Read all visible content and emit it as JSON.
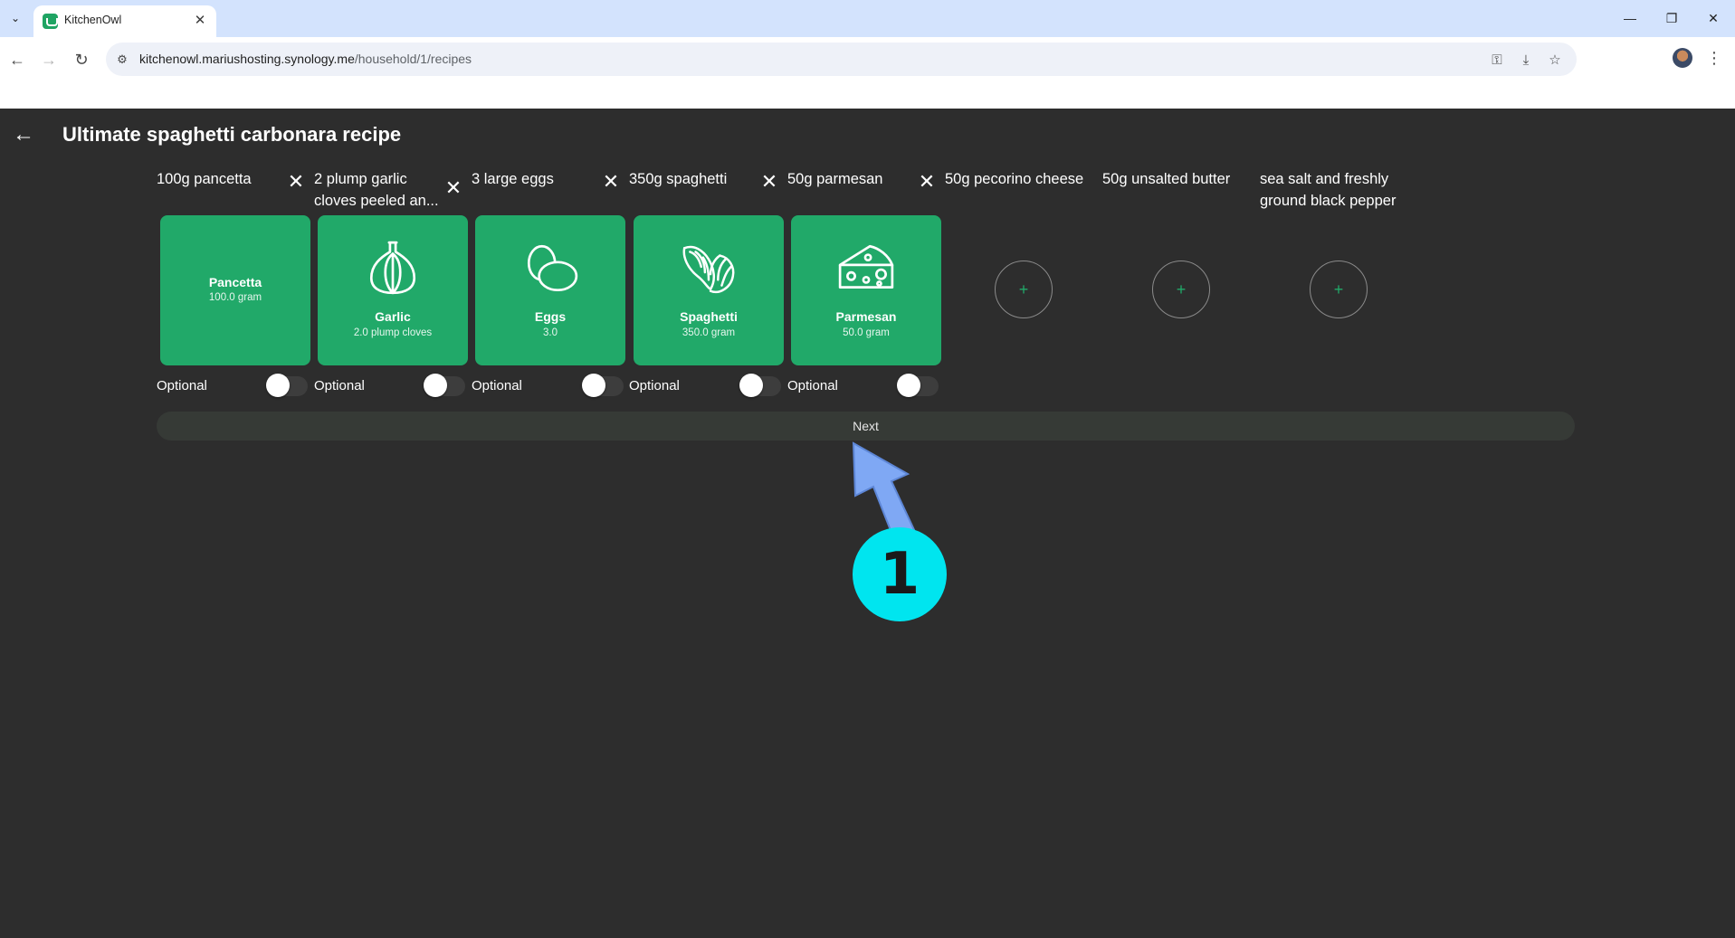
{
  "browser": {
    "tab_title": "KitchenOwl",
    "url_host": "kitchenowl.mariushosting.synology.me",
    "url_path": "/household/1/recipes"
  },
  "page": {
    "title": "Ultimate spaghetti carbonara recipe"
  },
  "ingredients": [
    {
      "text": "100g pancetta",
      "card": {
        "name": "Pancetta",
        "amount": "100.0 gram",
        "icon": null
      },
      "optional_label": "Optional",
      "optional": false
    },
    {
      "text_line1": "2 plump garlic",
      "text_line2": "cloves peeled an...",
      "card": {
        "name": "Garlic",
        "amount": "2.0 plump cloves",
        "icon": "garlic-icon"
      },
      "optional_label": "Optional",
      "optional": false
    },
    {
      "text": "3 large eggs",
      "card": {
        "name": "Eggs",
        "amount": "3.0",
        "icon": "eggs-icon"
      },
      "optional_label": "Optional",
      "optional": false
    },
    {
      "text": "350g spaghetti",
      "card": {
        "name": "Spaghetti",
        "amount": "350.0 gram",
        "icon": "pasta-icon"
      },
      "optional_label": "Optional",
      "optional": false
    },
    {
      "text": "50g parmesan",
      "card": {
        "name": "Parmesan",
        "amount": "50.0 gram",
        "icon": "cheese-icon"
      },
      "optional_label": "Optional",
      "optional": false
    },
    {
      "text": "50g pecorino cheese",
      "add": "+"
    },
    {
      "text": "50g unsalted butter",
      "add": "+"
    },
    {
      "text_line1": "sea salt and freshly",
      "text_line2": "ground black pepper",
      "add": "+"
    }
  ],
  "actions": {
    "remove_symbol": "✕",
    "next_label": "Next"
  },
  "annotation": {
    "badge": "1"
  },
  "colors": {
    "card_green": "#21a969",
    "background": "#2d2d2d",
    "badge_cyan": "#00e5ef",
    "arrow_blue": "#7fa8f4"
  }
}
